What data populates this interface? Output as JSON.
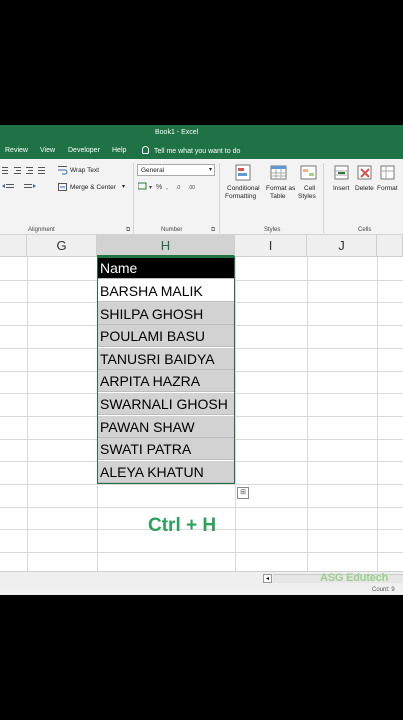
{
  "window": {
    "title": "Book1  -  Excel"
  },
  "ribbon_tabs": [
    "Review",
    "View",
    "Developer",
    "Help"
  ],
  "tell_me": "Tell me what you want to do",
  "alignment": {
    "wrap_text": "Wrap Text",
    "merge_center": "Merge & Center",
    "group": "Alignment"
  },
  "number": {
    "format_value": "General",
    "group": "Number"
  },
  "styles": {
    "conditional_1": "Conditional",
    "conditional_2": "Formatting",
    "format_as_1": "Format as",
    "format_as_2": "Table",
    "cell_styles_1": "Cell",
    "cell_styles_2": "Styles",
    "group": "Styles"
  },
  "cells": {
    "insert": "Insert",
    "delete": "Delete",
    "format": "Format",
    "group": "Cells"
  },
  "columns": [
    "G",
    "H",
    "I",
    "J"
  ],
  "sheet": {
    "header": "Name",
    "names": [
      "BARSHA MALIK",
      "SHILPA GHOSH",
      "POULAMI BASU",
      "TANUSRI BAIDYA",
      "ARPITA HAZRA",
      "SWARNALI GHOSH",
      "PAWAN SHAW",
      "SWATI PATRA",
      "ALEYA KHATUN"
    ]
  },
  "shortcut": "Ctrl + H",
  "watermark": "ASG Edutech",
  "status": {
    "count": "Count: 9"
  },
  "colors": {
    "excel_green": "#217346",
    "selection_gray": "#d2d2d2",
    "shortcut_green": "#2aa25a"
  }
}
